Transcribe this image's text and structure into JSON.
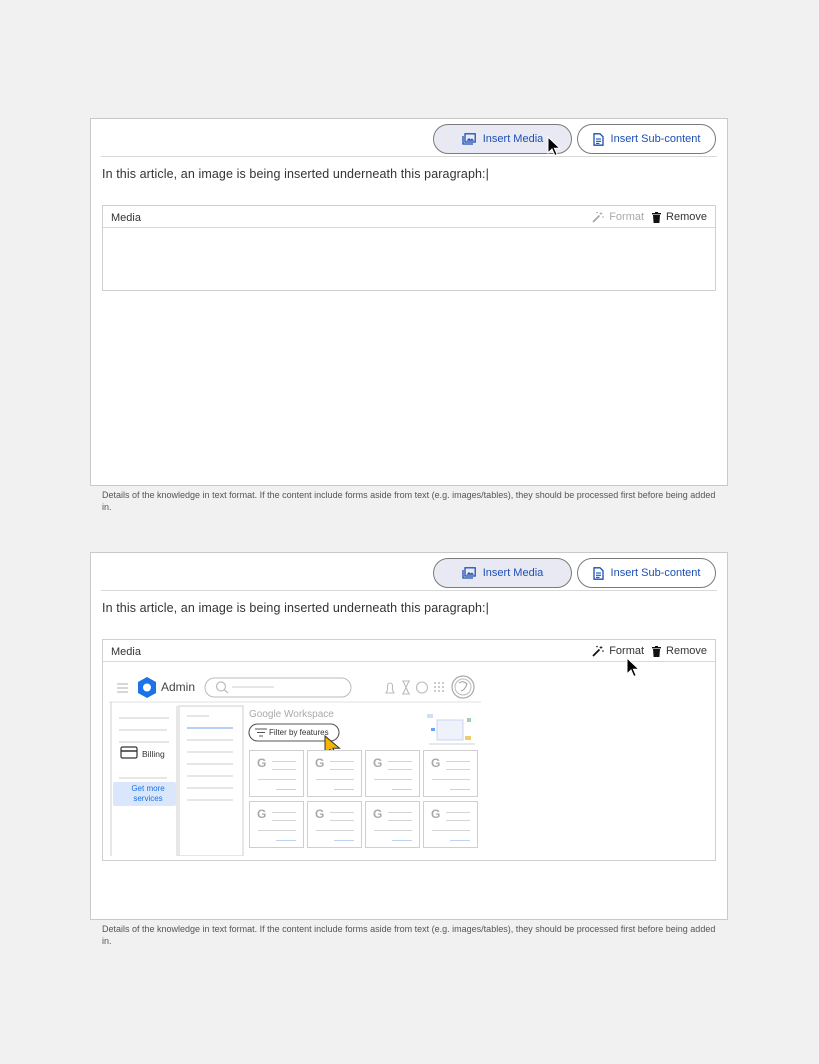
{
  "toolbar": {
    "insert_media_label": "Insert Media",
    "insert_subcontent_label": "Insert Sub-content"
  },
  "article": {
    "text": "In this article, an image is being inserted underneath this paragraph:|"
  },
  "media_block": {
    "title": "Media",
    "format_label": "Format",
    "remove_label": "Remove"
  },
  "helper_text": "Details of the knowledge in text format. If the content include forms aside from text (e.g. images/tables), they should be processed first before being added in.",
  "inserted_image": {
    "admin_label": "Admin",
    "workspace_label": "Google Workspace",
    "filter_label": "Filter by features",
    "billing_label": "Billing",
    "get_more_label": "Get more services"
  },
  "colors": {
    "accent_text": "#1a4fb4",
    "media_button_bg": "#e9e9f4",
    "admin_logo": "#1a73e8"
  }
}
